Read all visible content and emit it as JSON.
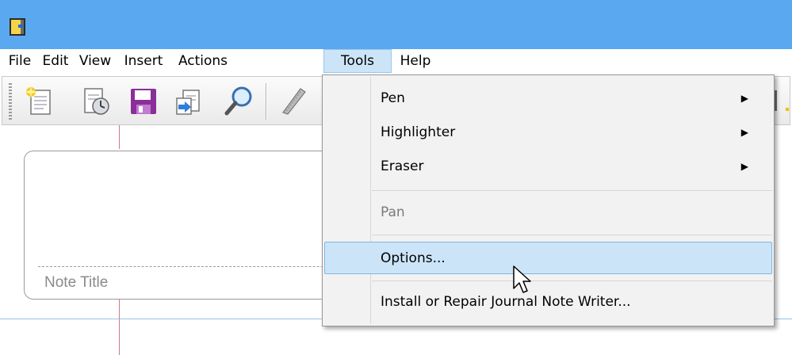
{
  "menubar": {
    "items": [
      "File",
      "Edit",
      "View",
      "Insert",
      "Actions",
      "Tools",
      "Help"
    ],
    "active": "Tools"
  },
  "toolbar": {
    "buttons": [
      "new-note-icon",
      "new-note-from-template-icon",
      "save-icon",
      "export-icon",
      "find-icon",
      "selection-tool-icon"
    ]
  },
  "note": {
    "title_placeholder": "Note Title"
  },
  "tools_menu": {
    "items": [
      {
        "label": "Pen",
        "submenu": true,
        "enabled": true
      },
      {
        "label": "Highlighter",
        "submenu": true,
        "enabled": true
      },
      {
        "label": "Eraser",
        "submenu": true,
        "enabled": true
      },
      {
        "label": "Pan",
        "submenu": false,
        "enabled": false
      },
      {
        "label": "Options...",
        "submenu": false,
        "enabled": true,
        "highlighted": true
      },
      {
        "label": "Install or Repair Journal Note Writer...",
        "submenu": false,
        "enabled": true
      }
    ],
    "arrow_glyph": "▶"
  },
  "colors": {
    "titlebar": "#5aa9f0",
    "menu_highlight": "#cce4f7",
    "note_margin_line": "#c47b8e"
  }
}
